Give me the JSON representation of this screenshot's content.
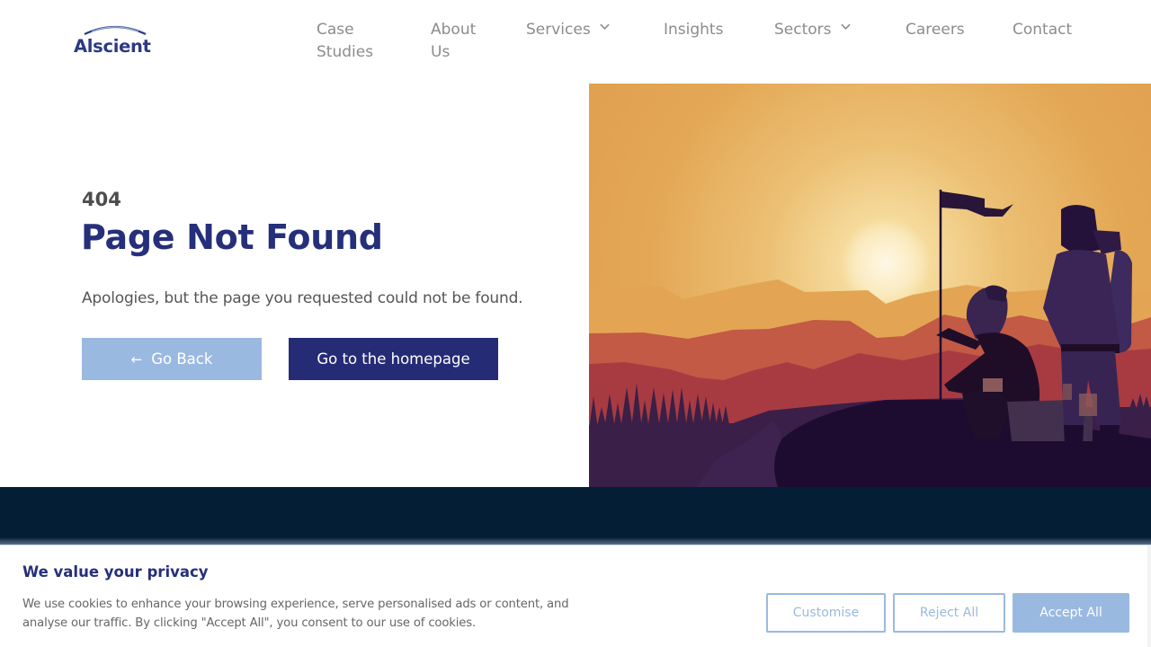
{
  "brand": {
    "name": "Alscient",
    "primary_color": "#252c75",
    "accent_color": "#9ab9e1",
    "footer_color": "#041e35"
  },
  "nav": {
    "items": [
      {
        "line1": "Case",
        "line2": "Studies",
        "has_dropdown": false
      },
      {
        "line1": "About",
        "line2": "Us",
        "has_dropdown": false
      },
      {
        "line1": "Services",
        "line2": "",
        "has_dropdown": true
      },
      {
        "line1": "Insights",
        "line2": "",
        "has_dropdown": false
      },
      {
        "line1": "Sectors",
        "line2": "",
        "has_dropdown": true
      },
      {
        "line1": "Careers",
        "line2": "",
        "has_dropdown": false
      },
      {
        "line1": "Contact",
        "line2": "",
        "has_dropdown": false
      }
    ]
  },
  "error": {
    "code": "404",
    "title": "Page Not Found",
    "message": "Apologies, but the page you requested could not be found.",
    "back_icon": "arrow-left-icon",
    "back_label": "Go Back",
    "home_label": "Go to the homepage"
  },
  "illustration": {
    "description": "Two hikers at sunset on a mountain top, one seated holding a flag, one standing with a backpack"
  },
  "cookie_banner": {
    "title": "We value your privacy",
    "text": "We use cookies to enhance your browsing experience, serve personalised ads or content, and analyse our traffic. By clicking \"Accept All\", you consent to our use of cookies.",
    "customise_label": "Customise",
    "reject_label": "Reject All",
    "accept_label": "Accept All"
  }
}
